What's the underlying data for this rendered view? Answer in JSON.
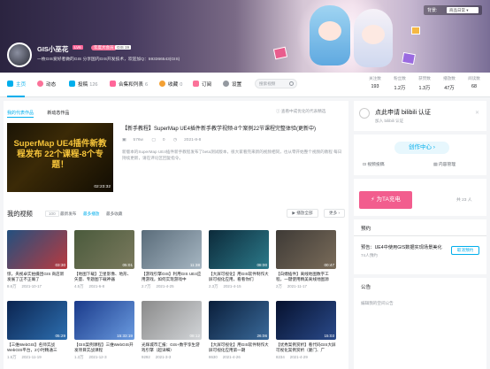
{
  "header": {
    "bg_label": "背景:",
    "bg_select": "商品日常 ▾",
    "username": "GIS小巫花",
    "level": "LV6",
    "vip": "年度大会员",
    "fans_badge": "GIS 19",
    "signature": "一枚GIS爱好者做的GIS 分享国内GIS开发技术，欢迎加Q：593366543(GIS)"
  },
  "nav": {
    "items": [
      {
        "label": "主页",
        "count": "",
        "color": "#00aeec"
      },
      {
        "label": "动态",
        "count": "",
        "color": "#fb7299"
      },
      {
        "label": "投稿",
        "count": "126",
        "color": "#00aeec"
      },
      {
        "label": "合集和列表",
        "count": "6",
        "color": "#ff6699"
      },
      {
        "label": "收藏",
        "count": "0",
        "color": "#f3a034"
      },
      {
        "label": "订阅",
        "count": "",
        "color": "#fb7299"
      },
      {
        "label": "设置",
        "count": "",
        "color": "#9499a0"
      }
    ],
    "search_placeholder": "搜索视频"
  },
  "stats": [
    {
      "label": "关注数",
      "value": "193"
    },
    {
      "label": "粉丝数",
      "value": "1.2万"
    },
    {
      "label": "获赞数",
      "value": "1.3万"
    },
    {
      "label": "播放数",
      "value": "47万"
    },
    {
      "label": "阅读数",
      "value": "68"
    }
  ],
  "featured": {
    "tabs": [
      "我的代表作品",
      "新动态作品"
    ],
    "tip": "ⓘ 查看中成优化的代表精选",
    "thumb_text": "SuperMap UE4插件新教程发布 22个课程-8个专题！",
    "duration": "02:23:32",
    "title": "【新手教程】SuperMap UE4插件新手教学视频-8个案例22节课程完整体验(更新中)",
    "views": "576w",
    "comments": "0",
    "date": "2021-8-8",
    "desc": "新版本的SuperMap UE4插件新手教程发布了beta测试版本，很大家看完来新的视频相同，也从零开始整个视频的教程 每日持续更新，请在评论区回复指令。"
  },
  "videos": {
    "title": "我的视频",
    "count": "100",
    "sort_options": [
      "最新发布",
      "最多播放",
      "最多收藏"
    ],
    "play_all": "▶ 播放全部",
    "more": "更多 ›",
    "items": [
      {
        "title": "惊，央视卓实拍摄团GIS 商店新发展了正不正确了",
        "views": "8.6万",
        "date": "2021-10-17",
        "duration": "03:30",
        "c1": "#23507f",
        "c2": "#b93a3f"
      },
      {
        "title": "【地图下载】卫星影像、地形、矢量、专题图下载神器",
        "views": "4.5万",
        "date": "2021-6-8",
        "duration": "05:01",
        "c1": "#4a5a3c",
        "c2": "#7b7a5e"
      },
      {
        "title": "【游戏引擎GIS】利用GIS UE4应用游戏，如何实现游戏中",
        "views": "2.7万",
        "date": "2021-4-25",
        "duration": "11:38",
        "c1": "#5a6c7a",
        "c2": "#a6b6c2"
      },
      {
        "title": "【大屏可视化】用GIS软件制作大屏可视化应用，看看你们",
        "views": "2.3万",
        "date": "2021-4-15",
        "duration": "08:00",
        "c1": "#0c2a3a",
        "c2": "#2c7a8a"
      },
      {
        "title": "【白嫖插件】离线地图数字工程，一键使用精美离线地图源",
        "views": "2万",
        "date": "2021-11-17",
        "duration": "00:47",
        "c1": "#3e3a36",
        "c2": "#7a6c5a"
      },
      {
        "title": "【三维WebGIS】名师实战WebGIS平台，2小时精通三",
        "views": "1.5万",
        "date": "2021-11-19",
        "duration": "05:29",
        "c1": "#0b2450",
        "c2": "#2d6fb0"
      },
      {
        "title": "【GIS案例课程】三维WebGIS开发项目实战课程",
        "views": "1.3万",
        "date": "2021-12-3",
        "duration": "15:33:19",
        "c1": "#1a3a8a",
        "c2": "#6a9be0"
      },
      {
        "title": "光辉城市汇报：GIS+数字孪生游戏引擎（超详细）",
        "views": "9292",
        "date": "2021-3-3",
        "duration": "08:12",
        "c1": "#8a8a8a",
        "c2": "#d2d5d8"
      },
      {
        "title": "【大屏可视化】用GIS软件制作大屏可视化应用第一期",
        "views": "8630",
        "date": "2021-4-26",
        "duration": "26:06",
        "c1": "#0a1e3a",
        "c2": "#3a6a9a"
      },
      {
        "title": "【优秀案例赏析】看代码GIS大屏可视化案例赏析（厦门、广",
        "views": "8234",
        "date": "2021-4-29",
        "duration": "15:03",
        "c1": "#06112e",
        "c2": "#2a4a8a"
      }
    ]
  },
  "sidebar": {
    "auth_title": "点此申请 bilibili 认证",
    "auth_sub": "加入 bilibili 认证",
    "create_center": "创作中心 ›",
    "link1": "视频投稿",
    "link2": "内容管理",
    "charge_btn": "为TA充电",
    "charge_count": "共 23 人",
    "notice_title": "预约",
    "notice_text": "预告：UE4中使用GIS数据实现场景美化",
    "notice_meta": "74人预约",
    "notice_btn": "取消预约",
    "announce_title": "公告",
    "announce_text": "编辑我的空间公告"
  },
  "colors": {
    "accent": "#00aeec",
    "pink": "#fb7299"
  }
}
